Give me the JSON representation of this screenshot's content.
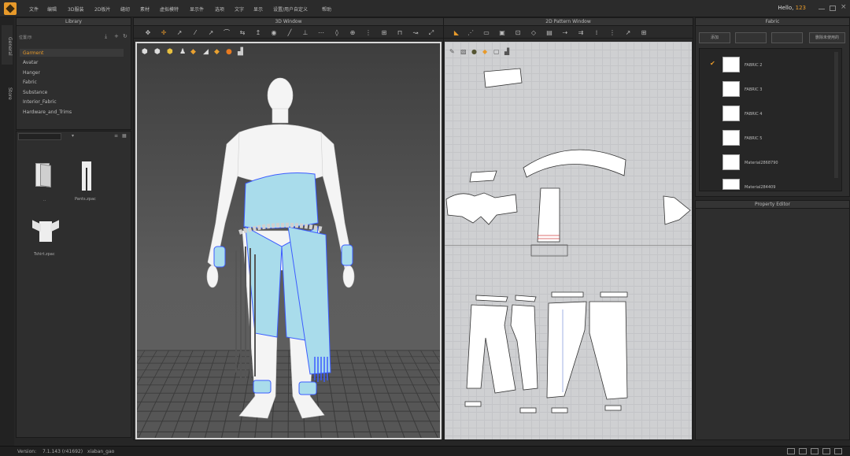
{
  "menu": [
    "文件",
    "编辑",
    "3D服装",
    "2D板片",
    "缝纫",
    "素材",
    "虚拟模特",
    "显示件",
    "选项",
    "文字",
    "显示",
    "设置/用户自定义",
    "帮助"
  ],
  "greeting": {
    "prefix": "Hello,",
    "user": "123"
  },
  "side_tabs": [
    "General",
    "Store"
  ],
  "library": {
    "title": "Library",
    "folder_label": "位置/示",
    "items": [
      "Garment",
      "Avatar",
      "Hanger",
      "Fabric",
      "Substance",
      "Interior_Fabric",
      "Hardware_and_Trims"
    ],
    "selected_index": 0,
    "files": [
      {
        "label": "..",
        "icon": "folder-icon"
      },
      {
        "label": "Pants.zpac",
        "icon": "pants-icon"
      },
      {
        "label": "Tshirt.zpac",
        "icon": "tshirt-icon"
      }
    ]
  },
  "viewport3d": {
    "title": "3D Window"
  },
  "viewport2d": {
    "title": "2D Pattern Window"
  },
  "fabric": {
    "title": "Fabric",
    "buttons": [
      "添加",
      "",
      "",
      "删除未使用的"
    ],
    "items": [
      "FABRIC 2",
      "FABRIC 3",
      "FABRIC 4",
      "FABRIC 5",
      "Material2868790",
      "Material284409"
    ],
    "checked_index": 0
  },
  "property_editor": {
    "title": "Property Editor"
  },
  "status": {
    "version_label": "Version:",
    "version": "7.1.143 (r41692)",
    "user": "xiaban_gao"
  },
  "colors": {
    "accent": "#e89a2a",
    "garment": "#a9dceb",
    "seam": "#3c5cff"
  }
}
